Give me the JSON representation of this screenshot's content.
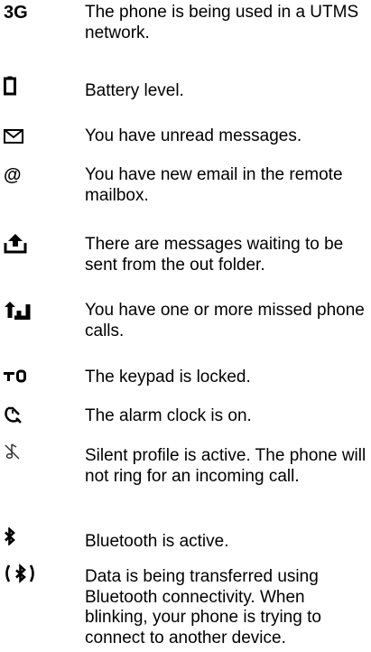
{
  "items": [
    {
      "icon": "3g-text-icon",
      "icon_text": "3G",
      "text": "The phone is being used in a UTMS network."
    },
    {
      "icon": "battery-icon",
      "text": "Battery level."
    },
    {
      "icon": "envelope-icon",
      "text": "You have unread messages."
    },
    {
      "icon": "at-sign-icon",
      "icon_text": "@",
      "text": "You have new email in the remote mailbox."
    },
    {
      "icon": "outbox-upload-icon",
      "text": "There are messages waiting to be sent from the out folder."
    },
    {
      "icon": "missed-call-icon",
      "text": "You have one or more missed phone calls."
    },
    {
      "icon": "keypad-lock-icon",
      "text": "The keypad is locked."
    },
    {
      "icon": "alarm-clock-icon",
      "text": "The alarm clock is on."
    },
    {
      "icon": "silent-profile-icon",
      "text": "Silent profile is active.  The phone will not ring for an incoming call."
    },
    {
      "icon": "bluetooth-icon",
      "text": "Bluetooth is active."
    },
    {
      "icon": "bluetooth-data-icon",
      "text": "Data is being transferred using Bluetooth connectivity.  When blinking, your phone is trying to connect to another device."
    }
  ]
}
